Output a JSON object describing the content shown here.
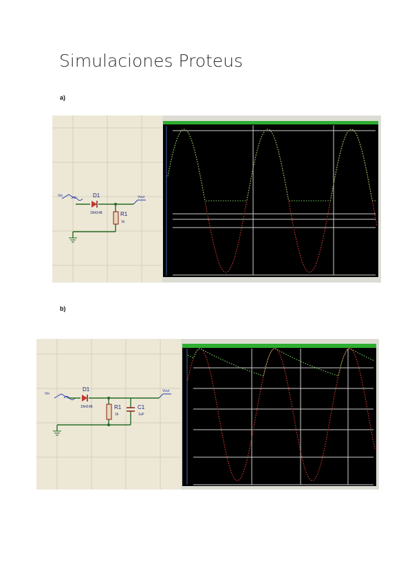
{
  "page": {
    "title": "Simulaciones Proteus"
  },
  "sections": [
    {
      "label": "a)",
      "schematic": {
        "diode_name": "D1",
        "diode_part": "1N4148",
        "resistor_name": "R1",
        "resistor_value": "1k",
        "input_terminal": "Vin",
        "output_terminal": "Vout"
      },
      "oscilloscope": {
        "input_trace_color": "#e8403a",
        "output_trace_color": "#7fd86a",
        "background_color": "#000000",
        "header_color": "#2fae31"
      },
      "chart_data": {
        "type": "line",
        "series": [
          {
            "color": "#e8403a",
            "shape": "sine",
            "cycles": 2.5,
            "y_range": [
              -1,
              1
            ]
          },
          {
            "color": "#7fd86a",
            "shape": "half-wave rectified sine",
            "cycles": 2.5,
            "y_range": [
              0,
              1
            ]
          }
        ]
      }
    },
    {
      "label": "b)",
      "schematic": {
        "diode_name": "D1",
        "diode_part": "1N4148",
        "resistor_name": "R1",
        "resistor_value": "1k",
        "capacitor_name": "C1",
        "capacitor_value": "1uF",
        "input_terminal": "Vin",
        "output_terminal": "Vout"
      },
      "oscilloscope": {
        "input_trace_color": "#e8403a",
        "output_trace_color": "#7fd86a",
        "background_color": "#000000",
        "header_color": "#2fae31"
      },
      "chart_data": {
        "type": "line",
        "series": [
          {
            "color": "#e8403a",
            "shape": "sine",
            "cycles": 2.5,
            "y_range": [
              -1,
              1
            ]
          },
          {
            "color": "#7fd86a",
            "shape": "half-wave rectified with capacitor ripple",
            "cycles": 2.5,
            "y_range": [
              0.8,
              1
            ]
          }
        ]
      }
    }
  ]
}
